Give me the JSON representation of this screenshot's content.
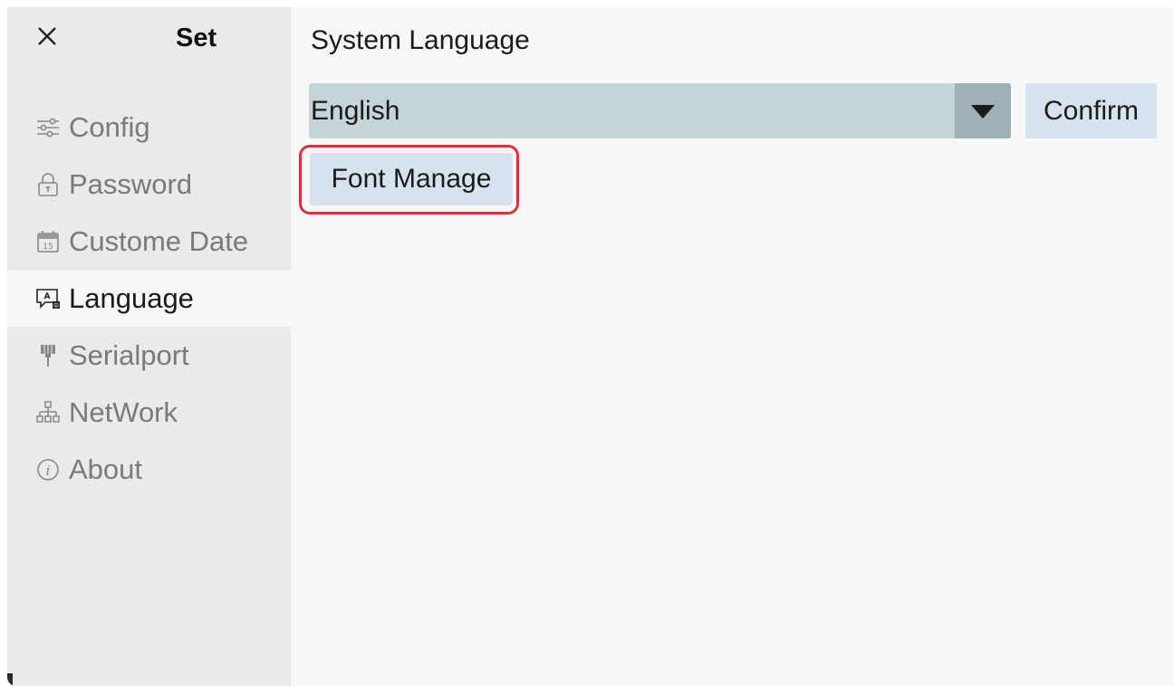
{
  "sidebar": {
    "title": "Set",
    "close_icon": "close-icon",
    "items": [
      {
        "label": "Config",
        "icon": "sliders-icon",
        "active": false
      },
      {
        "label": "Password",
        "icon": "lock-icon",
        "active": false
      },
      {
        "label": "Custome Date",
        "icon": "calendar-icon",
        "active": false
      },
      {
        "label": "Language",
        "icon": "language-icon",
        "active": true
      },
      {
        "label": "Serialport",
        "icon": "serial-plug-icon",
        "active": false
      },
      {
        "label": "NetWork",
        "icon": "network-icon",
        "active": false
      },
      {
        "label": "About",
        "icon": "info-icon",
        "active": false
      }
    ]
  },
  "main": {
    "section_label": "System Language",
    "language_select": {
      "value": "English"
    },
    "confirm_label": "Confirm",
    "font_manage_label": "Font Manage"
  },
  "colors": {
    "sidebar_bg": "#eaeaea",
    "main_bg": "#f7f7f7",
    "select_bg": "#c5d4d9",
    "button_bg": "#d6e3ef",
    "highlight": "#d9333d"
  }
}
